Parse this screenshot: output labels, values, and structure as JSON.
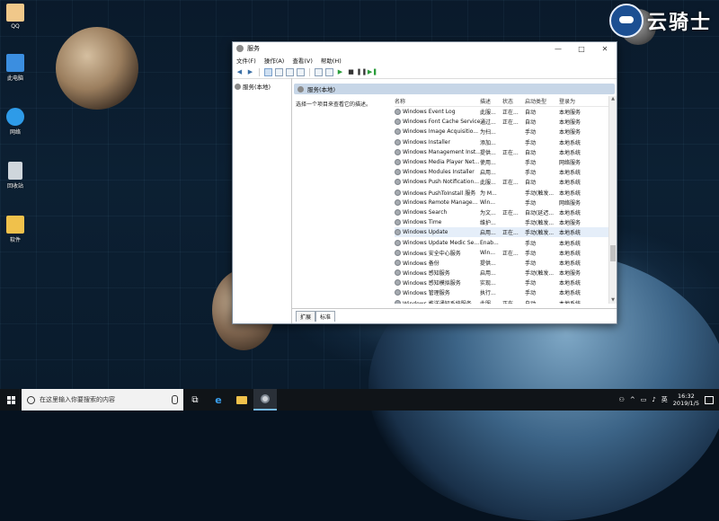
{
  "desktop": {
    "icons": [
      {
        "label": "QQ",
        "color": "#f0c88a"
      },
      {
        "label": "此电脑",
        "color": "#3b8ee0"
      },
      {
        "label": "网络",
        "color": "#2e9be8"
      },
      {
        "label": "回收站",
        "color": "#cfd6dc"
      },
      {
        "label": "软件",
        "color": "#f0c14b"
      }
    ],
    "watermark": "云骑士"
  },
  "window": {
    "title": "服务",
    "controls": {
      "minimize": "—",
      "maximize": "□",
      "close": "✕"
    },
    "menu": [
      "文件(F)",
      "操作(A)",
      "查看(V)",
      "帮助(H)"
    ],
    "tree": {
      "item": "服务(本地)"
    },
    "pane_header": "服务(本地)",
    "description": "选择一个项目来查看它的描述。",
    "columns": {
      "name": "名称",
      "desc": "描述",
      "status": "状态",
      "startup": "启动类型",
      "logon": "登录为"
    },
    "services": [
      {
        "name": "Windows Event Log",
        "desc": "此服...",
        "status": "正在...",
        "startup": "自动",
        "logon": "本地服务"
      },
      {
        "name": "Windows Font Cache Service",
        "desc": "通过...",
        "status": "正在...",
        "startup": "自动",
        "logon": "本地服务"
      },
      {
        "name": "Windows Image Acquisitio...",
        "desc": "为扫...",
        "status": "",
        "startup": "手动",
        "logon": "本地服务"
      },
      {
        "name": "Windows Installer",
        "desc": "添加...",
        "status": "",
        "startup": "手动",
        "logon": "本地系统"
      },
      {
        "name": "Windows Management Inst...",
        "desc": "提供...",
        "status": "正在...",
        "startup": "自动",
        "logon": "本地系统"
      },
      {
        "name": "Windows Media Player Net...",
        "desc": "使用...",
        "status": "",
        "startup": "手动",
        "logon": "网络服务"
      },
      {
        "name": "Windows Modules Installer",
        "desc": "启用...",
        "status": "",
        "startup": "手动",
        "logon": "本地系统"
      },
      {
        "name": "Windows Push Notification...",
        "desc": "此服...",
        "status": "正在...",
        "startup": "自动",
        "logon": "本地系统"
      },
      {
        "name": "Windows PushToInstall 服务",
        "desc": "为 M...",
        "status": "",
        "startup": "手动(触发...",
        "logon": "本地系统"
      },
      {
        "name": "Windows Remote Manage...",
        "desc": "Win...",
        "status": "",
        "startup": "手动",
        "logon": "网络服务"
      },
      {
        "name": "Windows Search",
        "desc": "为文...",
        "status": "正在...",
        "startup": "自动(延迟...",
        "logon": "本地系统"
      },
      {
        "name": "Windows Time",
        "desc": "维护...",
        "status": "",
        "startup": "手动(触发...",
        "logon": "本地服务"
      },
      {
        "name": "Windows Update",
        "desc": "启用...",
        "status": "正在...",
        "startup": "手动(触发...",
        "logon": "本地系统"
      },
      {
        "name": "Windows Update Medic Se...",
        "desc": "Enab...",
        "status": "",
        "startup": "手动",
        "logon": "本地系统"
      },
      {
        "name": "Windows 安全中心服务",
        "desc": "Win...",
        "status": "正在...",
        "startup": "手动",
        "logon": "本地系统"
      },
      {
        "name": "Windows 备份",
        "desc": "提供...",
        "status": "",
        "startup": "手动",
        "logon": "本地系统"
      },
      {
        "name": "Windows 感知服务",
        "desc": "启用...",
        "status": "",
        "startup": "手动(触发...",
        "logon": "本地服务"
      },
      {
        "name": "Windows 感知模拟服务",
        "desc": "实现...",
        "status": "",
        "startup": "手动",
        "logon": "本地系统"
      },
      {
        "name": "Windows 管理服务",
        "desc": "执行...",
        "status": "",
        "startup": "手动",
        "logon": "本地系统"
      },
      {
        "name": "Windows 推送通知系统服务",
        "desc": "此服...",
        "status": "正在...",
        "startup": "自动",
        "logon": "本地系统"
      }
    ],
    "selected_index": 12,
    "tabs": [
      "扩展",
      "标准"
    ]
  },
  "taskbar": {
    "search_placeholder": "在这里输入你要搜索的内容",
    "time": "16:32",
    "date": "2019/1/5",
    "tray_lang": "英"
  }
}
